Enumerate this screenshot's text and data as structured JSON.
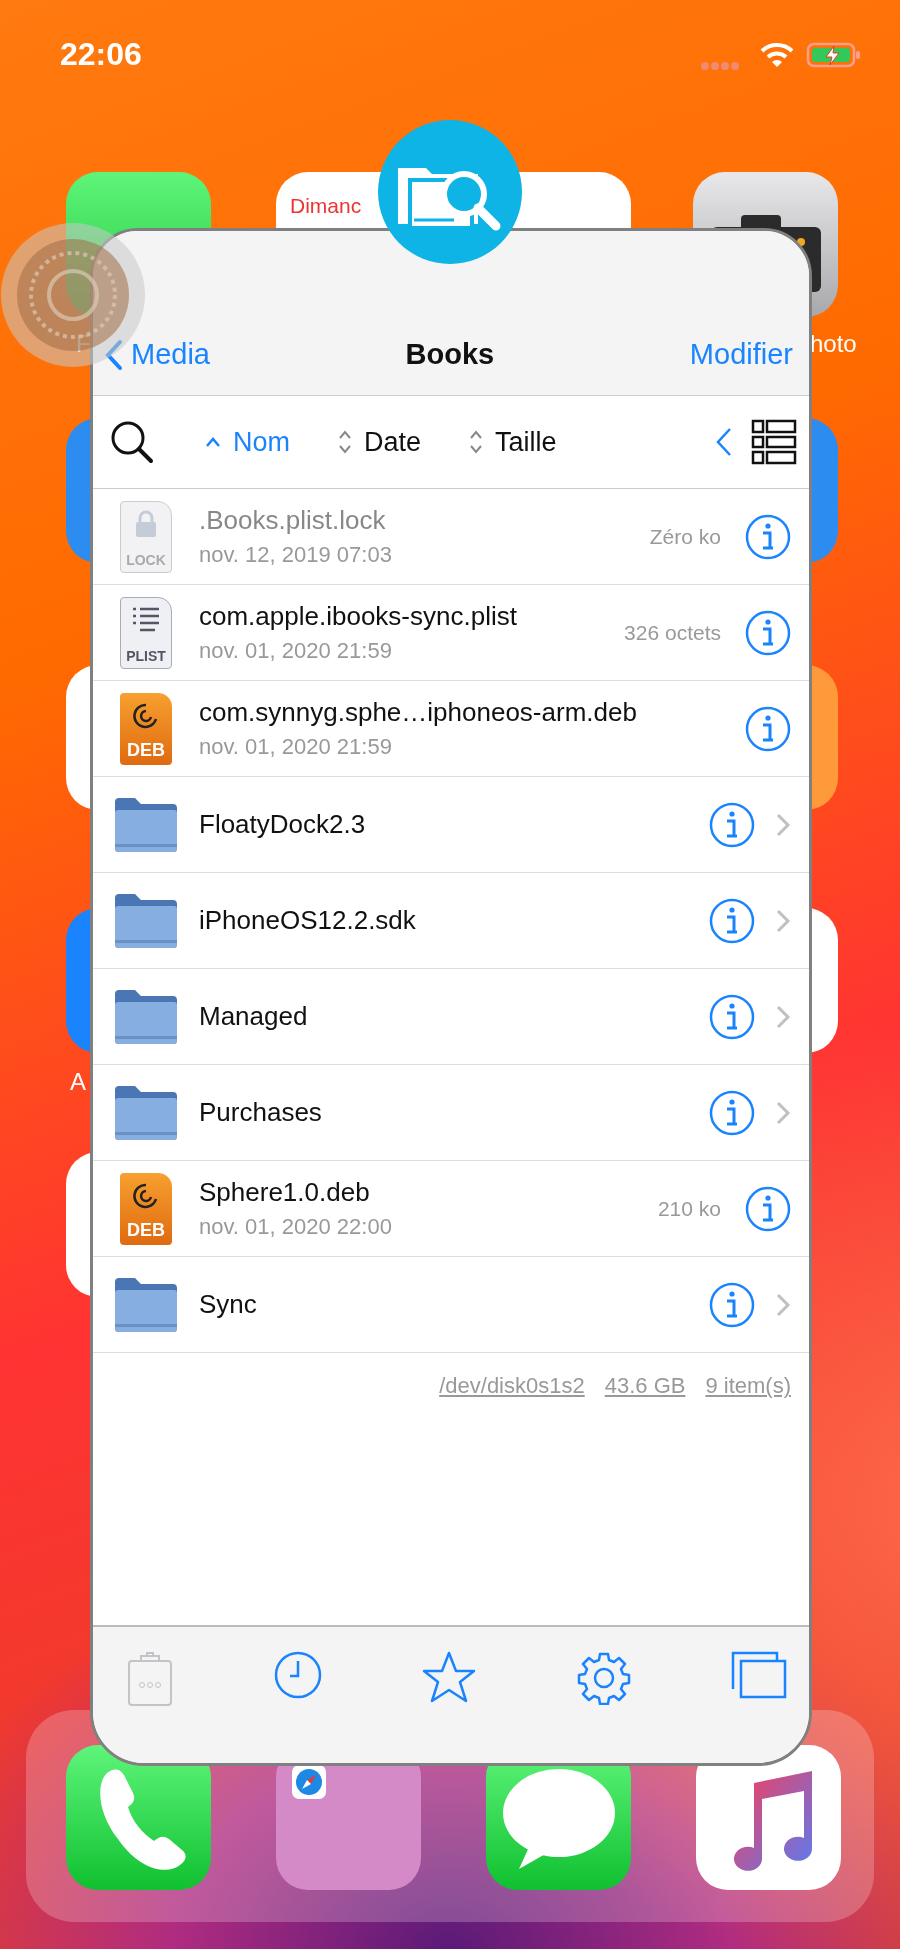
{
  "status_bar": {
    "time": "22:06"
  },
  "home_screen": {
    "labels": [
      {
        "text": "F",
        "kind": "left"
      },
      {
        "text": "hoto",
        "kind": "right"
      },
      {
        "text": "A",
        "kind": "left2"
      }
    ],
    "calendar_day": "Dimanc"
  },
  "window": {
    "nav": {
      "back": "Media",
      "title": "Books",
      "action": "Modifier"
    },
    "sort": [
      {
        "label": "Nom",
        "selected": true
      },
      {
        "label": "Date",
        "selected": false
      },
      {
        "label": "Taille",
        "selected": false
      }
    ],
    "rows": [
      {
        "kind": "lock",
        "badge": "LOCK",
        "name": ".Books.plist.lock",
        "date": "nov. 12, 2019 07:03",
        "size": "Zéro ko",
        "hidden": true
      },
      {
        "kind": "plist",
        "badge": "PLIST",
        "name": "com.apple.ibooks-sync.plist",
        "date": "nov. 01, 2020 21:59",
        "size": "326 octets",
        "hidden": false
      },
      {
        "kind": "deb",
        "badge": "DEB",
        "name": "com.synnyg.sphe…iphoneos-arm.deb",
        "date": "nov. 01, 2020 21:59",
        "hidden": false
      },
      {
        "kind": "folder",
        "name": "FloatyDock2.3",
        "hidden": false
      },
      {
        "kind": "folder",
        "name": "iPhoneOS12.2.sdk",
        "hidden": false
      },
      {
        "kind": "folder",
        "name": "Managed",
        "hidden": false
      },
      {
        "kind": "folder",
        "name": "Purchases",
        "hidden": false
      },
      {
        "kind": "deb",
        "badge": "DEB",
        "name": "Sphere1.0.deb",
        "date": "nov. 01, 2020 22:00",
        "size": "210 ko",
        "hidden": false
      },
      {
        "kind": "folder",
        "name": "Sync",
        "hidden": false
      }
    ],
    "footer": [
      "/dev/disk0s1s2",
      "43.6 GB",
      "9 item(s)"
    ],
    "toolbar": [
      {
        "kind": "clipboard",
        "disabled": true
      },
      {
        "kind": "clock",
        "disabled": false
      },
      {
        "kind": "star",
        "disabled": false
      },
      {
        "kind": "gear",
        "disabled": false
      },
      {
        "kind": "windows",
        "disabled": false
      }
    ]
  }
}
